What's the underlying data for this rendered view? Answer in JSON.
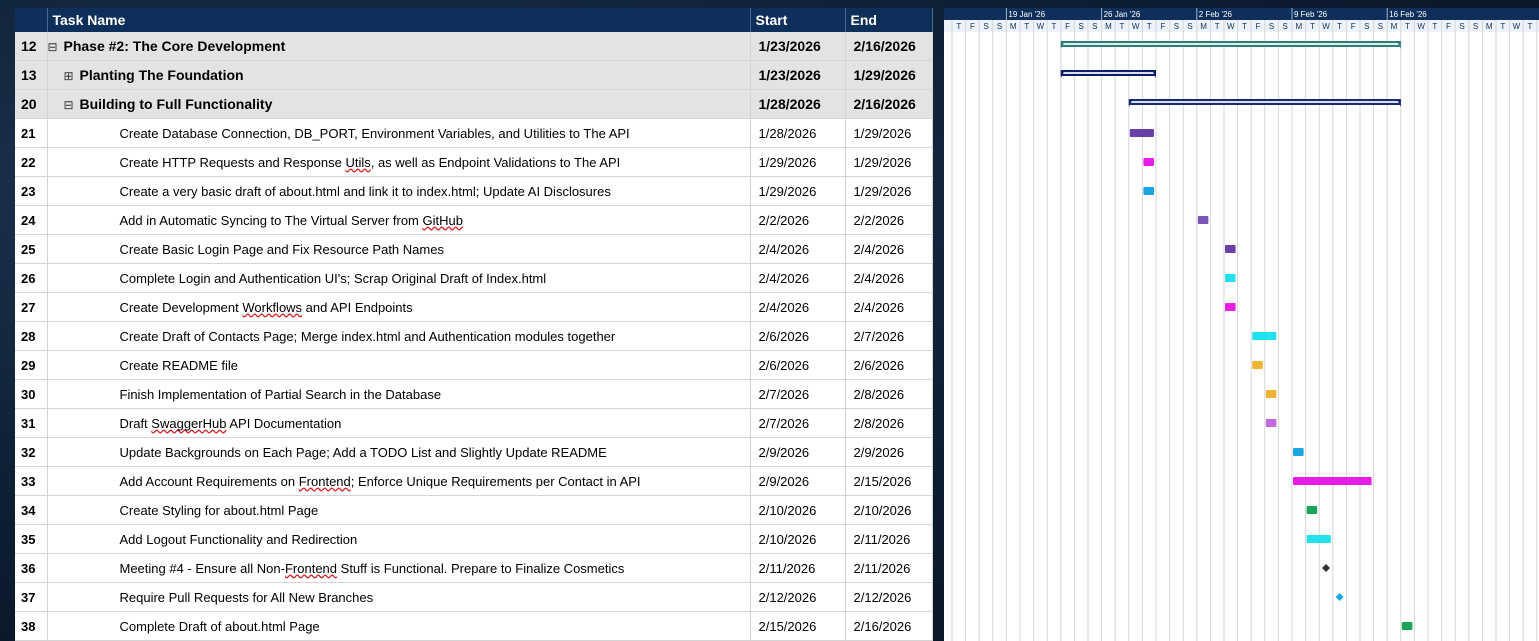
{
  "table": {
    "headers": {
      "id": "",
      "name": "Task Name",
      "start": "Start",
      "end": "End"
    },
    "rows": [
      {
        "id": "12",
        "name": "Phase #2: The Core Development",
        "start": "1/23/2026",
        "end": "2/16/2026",
        "summary": true,
        "level": 0,
        "toggle": "⊟"
      },
      {
        "id": "13",
        "name": "Planting The Foundation",
        "start": "1/23/2026",
        "end": "1/29/2026",
        "summary": true,
        "level": 1,
        "toggle": "⊞"
      },
      {
        "id": "20",
        "name": "Building to Full Functionality",
        "start": "1/28/2026",
        "end": "2/16/2026",
        "summary": true,
        "level": 1,
        "toggle": "⊟"
      },
      {
        "id": "21",
        "name": "Create Database Connection, DB_PORT, Environment Variables, and Utilities to The API",
        "start": "1/28/2026",
        "end": "1/29/2026"
      },
      {
        "id": "22",
        "name": "Create HTTP Requests and Response Utils, as well as Endpoint Validations to The API",
        "start": "1/29/2026",
        "end": "1/29/2026"
      },
      {
        "id": "23",
        "name": "Create a very basic draft of about.html and link it to index.html; Update AI Disclosures",
        "start": "1/29/2026",
        "end": "1/29/2026"
      },
      {
        "id": "24",
        "name": "Add in Automatic Syncing to The Virtual Server from GitHub",
        "start": "2/2/2026",
        "end": "2/2/2026"
      },
      {
        "id": "25",
        "name": "Create Basic Login Page and Fix Resource Path Names",
        "start": "2/4/2026",
        "end": "2/4/2026"
      },
      {
        "id": "26",
        "name": "Complete Login and Authentication UI's; Scrap Original Draft of Index.html",
        "start": "2/4/2026",
        "end": "2/4/2026"
      },
      {
        "id": "27",
        "name": "Create Development Workflows and API Endpoints",
        "start": "2/4/2026",
        "end": "2/4/2026"
      },
      {
        "id": "28",
        "name": "Create Draft of Contacts Page; Merge index.html and Authentication modules together",
        "start": "2/6/2026",
        "end": "2/7/2026"
      },
      {
        "id": "29",
        "name": "Create README file",
        "start": "2/6/2026",
        "end": "2/6/2026"
      },
      {
        "id": "30",
        "name": "Finish Implementation of Partial Search in the Database",
        "start": "2/7/2026",
        "end": "2/8/2026"
      },
      {
        "id": "31",
        "name": "Draft SwaggerHub API Documentation",
        "start": "2/7/2026",
        "end": "2/8/2026"
      },
      {
        "id": "32",
        "name": "Update Backgrounds on Each Page; Add a TODO List and Slightly Update README",
        "start": "2/9/2026",
        "end": "2/9/2026"
      },
      {
        "id": "33",
        "name": "Add Account Requirements on Frontend; Enforce Unique Requirements per Contact in API",
        "start": "2/9/2026",
        "end": "2/15/2026"
      },
      {
        "id": "34",
        "name": "Create Styling for about.html Page",
        "start": "2/10/2026",
        "end": "2/10/2026"
      },
      {
        "id": "35",
        "name": "Add Logout Functionality and Redirection",
        "start": "2/10/2026",
        "end": "2/11/2026"
      },
      {
        "id": "36",
        "name": "Meeting #4 - Ensure all Non-Frontend Stuff is Functional. Prepare to Finalize Cosmetics",
        "start": "2/11/2026",
        "end": "2/11/2026"
      },
      {
        "id": "37",
        "name": "Require Pull Requests for All New Branches",
        "start": "2/12/2026",
        "end": "2/12/2026"
      },
      {
        "id": "38",
        "name": "Complete Draft of about.html Page",
        "start": "2/15/2026",
        "end": "2/16/2026"
      }
    ]
  },
  "gantt": {
    "weeks": [
      "19 Jan '26",
      "26 Jan '26",
      "2 Feb '26",
      "9 Feb '26",
      "16 Feb '26"
    ],
    "day_letters": [
      "T",
      "F",
      "S",
      "S",
      "M",
      "T",
      "W",
      "T",
      "F",
      "S",
      "S",
      "M",
      "T",
      "W",
      "T",
      "F",
      "S",
      "S",
      "M",
      "T",
      "W",
      "T",
      "F",
      "S",
      "S",
      "M",
      "T",
      "W",
      "T",
      "F",
      "S",
      "S",
      "M",
      "T",
      "W",
      "T",
      "F",
      "S",
      "S",
      "M",
      "T",
      "W",
      "T"
    ],
    "first_day": "2026-01-15",
    "bars": [
      {
        "row": "12",
        "type": "summary",
        "start": "2026-01-23",
        "end": "2026-02-16",
        "color": "#2e7d7d"
      },
      {
        "row": "13",
        "type": "summary",
        "start": "2026-01-23",
        "end": "2026-01-29",
        "color": "#0b1d6b"
      },
      {
        "row": "20",
        "type": "summary",
        "start": "2026-01-28",
        "end": "2026-02-16",
        "color": "#1a2a7a"
      },
      {
        "row": "21",
        "type": "task",
        "start": "2026-01-28",
        "end": "2026-01-29",
        "color": "#6a3fa8"
      },
      {
        "row": "22",
        "type": "task",
        "start": "2026-01-29",
        "end": "2026-01-29",
        "color": "#e81ee8"
      },
      {
        "row": "23",
        "type": "task",
        "start": "2026-01-29",
        "end": "2026-01-29",
        "color": "#1aa6e0"
      },
      {
        "row": "24",
        "type": "task",
        "start": "2026-02-02",
        "end": "2026-02-02",
        "color": "#7a55b5"
      },
      {
        "row": "25",
        "type": "task",
        "start": "2026-02-04",
        "end": "2026-02-04",
        "color": "#6a3fa8"
      },
      {
        "row": "26",
        "type": "task",
        "start": "2026-02-04",
        "end": "2026-02-04",
        "color": "#22e0ec"
      },
      {
        "row": "27",
        "type": "task",
        "start": "2026-02-04",
        "end": "2026-02-04",
        "color": "#e81ee8"
      },
      {
        "row": "28",
        "type": "task",
        "start": "2026-02-06",
        "end": "2026-02-07",
        "color": "#22e0ec"
      },
      {
        "row": "29",
        "type": "task",
        "start": "2026-02-06",
        "end": "2026-02-06",
        "color": "#f0b435"
      },
      {
        "row": "30",
        "type": "task",
        "start": "2026-02-07",
        "end": "2026-02-07",
        "color": "#f0b435"
      },
      {
        "row": "31",
        "type": "task",
        "start": "2026-02-07",
        "end": "2026-02-07",
        "color": "#c46adf"
      },
      {
        "row": "32",
        "type": "task",
        "start": "2026-02-09",
        "end": "2026-02-09",
        "color": "#1aa6e0"
      },
      {
        "row": "33",
        "type": "task",
        "start": "2026-02-09",
        "end": "2026-02-14",
        "color": "#e81ee8"
      },
      {
        "row": "34",
        "type": "task",
        "start": "2026-02-10",
        "end": "2026-02-10",
        "color": "#1aa65a"
      },
      {
        "row": "35",
        "type": "task",
        "start": "2026-02-10",
        "end": "2026-02-11",
        "color": "#22e0ec"
      },
      {
        "row": "36",
        "type": "milestone",
        "start": "2026-02-11",
        "end": "2026-02-11",
        "color": "#333333"
      },
      {
        "row": "37",
        "type": "milestone",
        "start": "2026-02-12",
        "end": "2026-02-12",
        "color": "#1aa6e0"
      },
      {
        "row": "38",
        "type": "task",
        "start": "2026-02-17",
        "end": "2026-02-17",
        "color": "#1aa65a"
      }
    ]
  }
}
